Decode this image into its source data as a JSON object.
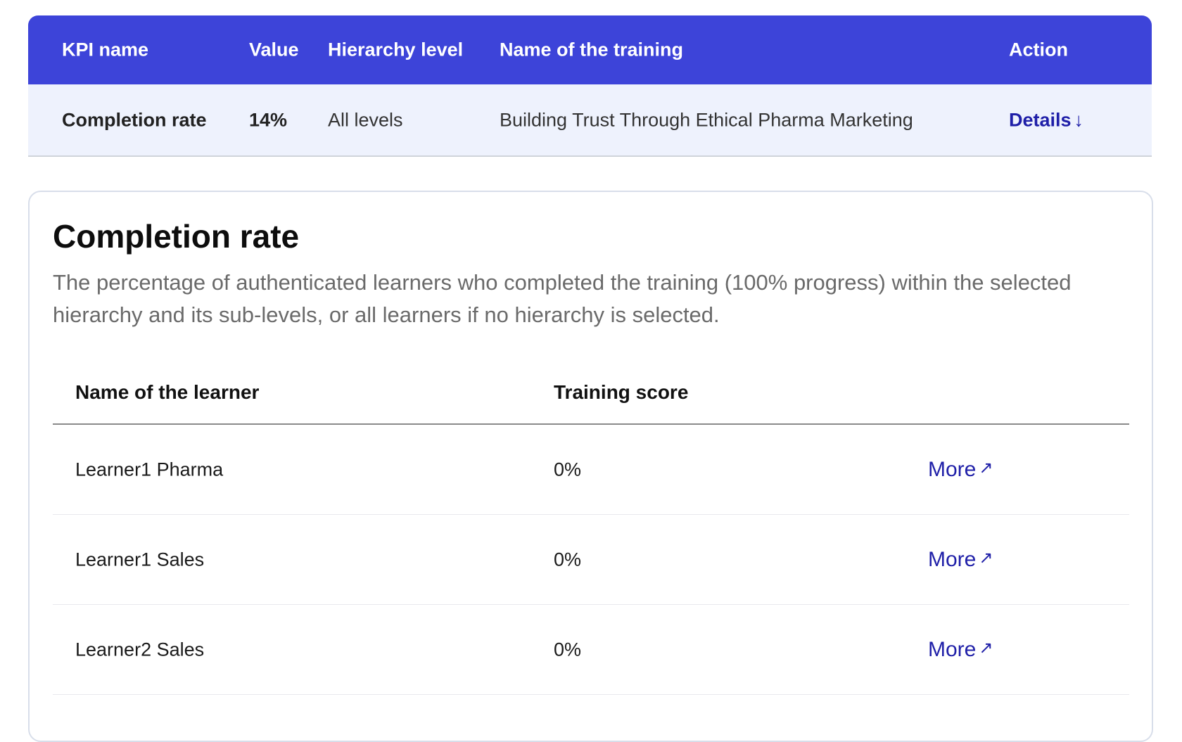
{
  "kpi_table": {
    "headers": {
      "kpi_name": "KPI name",
      "value": "Value",
      "hierarchy_level": "Hierarchy level",
      "training_name": "Name of the training",
      "action": "Action"
    },
    "row": {
      "kpi_name": "Completion rate",
      "value": "14%",
      "hierarchy_level": "All levels",
      "training_name": "Building Trust Through Ethical Pharma Marketing",
      "action_label": "Details",
      "action_icon": "arrow-down-icon"
    }
  },
  "detail_card": {
    "title": "Completion rate",
    "description": "The percentage of authenticated learners who completed the training (100% progress) within the selected hierarchy and its sub-levels, or all learners if no hierarchy is selected.",
    "table": {
      "headers": {
        "learner": "Name of the learner",
        "score": "Training score"
      },
      "rows": [
        {
          "learner": "Learner1 Pharma",
          "score": "0%",
          "action_label": "More"
        },
        {
          "learner": "Learner1 Sales",
          "score": "0%",
          "action_label": "More"
        },
        {
          "learner": "Learner2 Sales",
          "score": "0%",
          "action_label": "More"
        }
      ],
      "action_icon": "external-arrow-icon"
    }
  },
  "colors": {
    "header_bg": "#3d44d9",
    "row_bg": "#eef2fd",
    "link": "#1f1fa8"
  }
}
